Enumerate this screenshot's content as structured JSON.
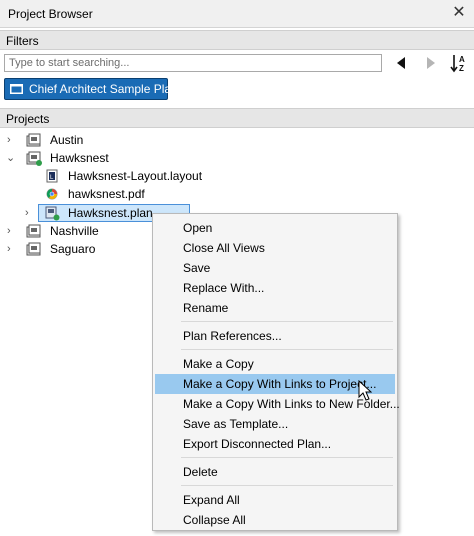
{
  "window": {
    "title": "Project Browser",
    "close_glyph": "✕"
  },
  "filters": {
    "header": "Filters",
    "search_placeholder": "Type to start searching...",
    "library_button": "Chief Architect Sample Plans"
  },
  "projects": {
    "header": "Projects",
    "tree": [
      {
        "label": "Austin",
        "expanded": false,
        "icon": "project-folder-icon"
      },
      {
        "label": "Hawksnest",
        "expanded": true,
        "icon": "project-folder-icon"
      },
      {
        "label": "Hawksnest-Layout.layout",
        "icon": "layout-file-icon"
      },
      {
        "label": "hawksnest.pdf",
        "icon": "pdf-file-icon"
      },
      {
        "label": "Hawksnest.plan",
        "icon": "plan-file-icon",
        "selected": true
      },
      {
        "label": "Nashville",
        "expanded": false,
        "icon": "project-folder-icon"
      },
      {
        "label": "Saguaro",
        "expanded": false,
        "icon": "project-folder-icon"
      }
    ]
  },
  "context_menu": {
    "items": [
      {
        "label": "Open"
      },
      {
        "label": "Close All Views"
      },
      {
        "label": "Save"
      },
      {
        "label": "Replace With..."
      },
      {
        "label": "Rename"
      },
      {
        "label": "Plan References..."
      },
      {
        "label": "Make a Copy"
      },
      {
        "label": "Make a Copy With Links to Project...",
        "highlighted": true
      },
      {
        "label": "Make a Copy With Links to New Folder..."
      },
      {
        "label": "Save as Template..."
      },
      {
        "label": "Export Disconnected Plan..."
      },
      {
        "label": "Delete"
      },
      {
        "label": "Expand All"
      },
      {
        "label": "Collapse All"
      }
    ]
  },
  "colors": {
    "accent": "#1a6bb5",
    "highlight": "#99c9ef",
    "selection": "#cde6fb"
  }
}
